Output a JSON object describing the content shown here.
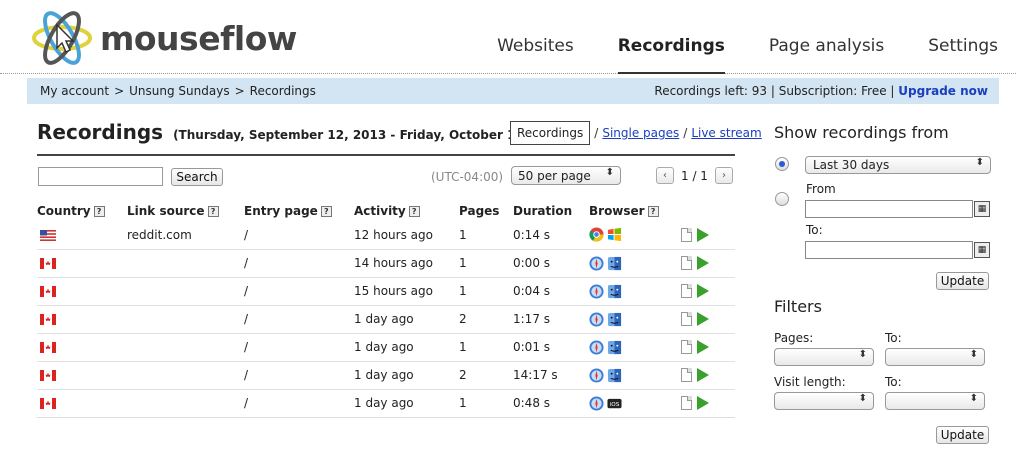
{
  "app": {
    "logo_text": "mouseflow"
  },
  "nav": [
    {
      "label": "Websites"
    },
    {
      "label": "Recordings",
      "active": true
    },
    {
      "label": "Page analysis"
    },
    {
      "label": "Settings"
    }
  ],
  "breadcrumb": [
    "My account",
    ">",
    "Unsung Sundays",
    ">",
    "Recordings"
  ],
  "status_bar": {
    "text": "Recordings left: 93 | Subscription: Free |",
    "upgrade_label": "Upgrade now"
  },
  "page": {
    "title": "Recordings",
    "date_range": "(Thursday, September 12, 2013 - Friday, October 11, 2013)",
    "view_button": "Recordings",
    "view_sep1": "/",
    "single_pages_link": "Single pages",
    "view_sep2": "/",
    "live_stream_link": "Live stream"
  },
  "controls": {
    "search_value": "",
    "search_button": "Search",
    "timezone": "(UTC-04:00)",
    "per_page": "50 per page",
    "pager_prev": "‹",
    "pager_text": "1 / 1",
    "pager_next": "›"
  },
  "table": {
    "columns": [
      "Country",
      "Link source",
      "Entry page",
      "Activity",
      "Pages",
      "Duration",
      "Browser"
    ],
    "help_glyph": "?",
    "rows": [
      {
        "country": "US",
        "link_source": "reddit.com",
        "entry_page": "/",
        "activity": "12 hours ago",
        "pages": "1",
        "duration": "0:14 s",
        "browser": "chrome-icon",
        "os": "windows-icon"
      },
      {
        "country": "CA",
        "link_source": "",
        "entry_page": "/",
        "activity": "14 hours ago",
        "pages": "1",
        "duration": "0:00 s",
        "browser": "safari-icon",
        "os": "mac-finder-icon"
      },
      {
        "country": "CA",
        "link_source": "",
        "entry_page": "/",
        "activity": "15 hours ago",
        "pages": "1",
        "duration": "0:04 s",
        "browser": "safari-icon",
        "os": "mac-finder-icon"
      },
      {
        "country": "CA",
        "link_source": "",
        "entry_page": "/",
        "activity": "1 day ago",
        "pages": "2",
        "duration": "1:17 s",
        "browser": "safari-icon",
        "os": "mac-finder-icon"
      },
      {
        "country": "CA",
        "link_source": "",
        "entry_page": "/",
        "activity": "1 day ago",
        "pages": "1",
        "duration": "0:01 s",
        "browser": "safari-icon",
        "os": "mac-finder-icon"
      },
      {
        "country": "CA",
        "link_source": "",
        "entry_page": "/",
        "activity": "1 day ago",
        "pages": "2",
        "duration": "14:17 s",
        "browser": "safari-icon",
        "os": "mac-finder-icon"
      },
      {
        "country": "CA",
        "link_source": "",
        "entry_page": "/",
        "activity": "1 day ago",
        "pages": "1",
        "duration": "0:48 s",
        "browser": "safari-icon",
        "os": "ios-icon"
      }
    ]
  },
  "sidebar": {
    "show_heading": "Show recordings from",
    "range_selected": "Last 30 days",
    "from_label": "From",
    "to_label": "To:",
    "update_label": "Update",
    "filters_heading": "Filters",
    "pages_label": "Pages:",
    "pages_to_label": "To:",
    "visit_length_label": "Visit length:",
    "visit_to_label": "To:",
    "update2_label": "Update"
  },
  "colors": {
    "accent_link": "#1a3fbf",
    "bar_bg": "#d3e4f2",
    "play_green": "#3aa02e"
  }
}
